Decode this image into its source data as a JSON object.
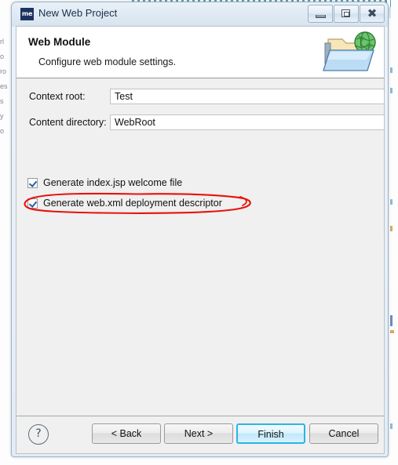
{
  "window": {
    "title": "New Web Project",
    "icon": "myeclipse-me-icon",
    "icon_text": "me",
    "controls": [
      {
        "name": "minimize-button",
        "glyph": "minimize"
      },
      {
        "name": "restore-button",
        "glyph": "restore"
      },
      {
        "name": "close-button",
        "glyph": "✖"
      }
    ]
  },
  "header": {
    "title": "Web Module",
    "description": "Configure web module settings.",
    "icon": "folder-globe-icon"
  },
  "form": {
    "fields": [
      {
        "label": "Context root:",
        "value": "Test",
        "name": "context-root"
      },
      {
        "label": "Content directory:",
        "value": "WebRoot",
        "name": "content-directory"
      }
    ],
    "checkboxes": [
      {
        "label": "Generate index.jsp welcome file",
        "checked": true,
        "name": "generate-index-jsp"
      },
      {
        "label": "Generate web.xml deployment descriptor",
        "checked": true,
        "name": "generate-web-xml",
        "annotated": true
      }
    ]
  },
  "annotation": {
    "type": "hand-drawn-ellipse",
    "color": "#e8120c",
    "target": "Generate web.xml deployment descriptor"
  },
  "footer": {
    "help_label": "?",
    "buttons": [
      {
        "label": "< Back",
        "name": "back-button",
        "primary": false
      },
      {
        "label": "Next >",
        "name": "next-button",
        "primary": false
      },
      {
        "label": "Finish",
        "name": "finish-button",
        "primary": true
      },
      {
        "label": "Cancel",
        "name": "cancel-button",
        "primary": false
      }
    ]
  },
  "background": {
    "left_column_text": [
      "rl",
      "o",
      "ro",
      "es",
      "s",
      "y",
      "o"
    ]
  },
  "colors": {
    "title_bar": "#e2ecf5",
    "dialog_body": "#f0f0f0",
    "header_white": "#ffffff",
    "primary_border": "#2bb4e8",
    "annotation_red": "#e8120c",
    "text": "#111111"
  }
}
